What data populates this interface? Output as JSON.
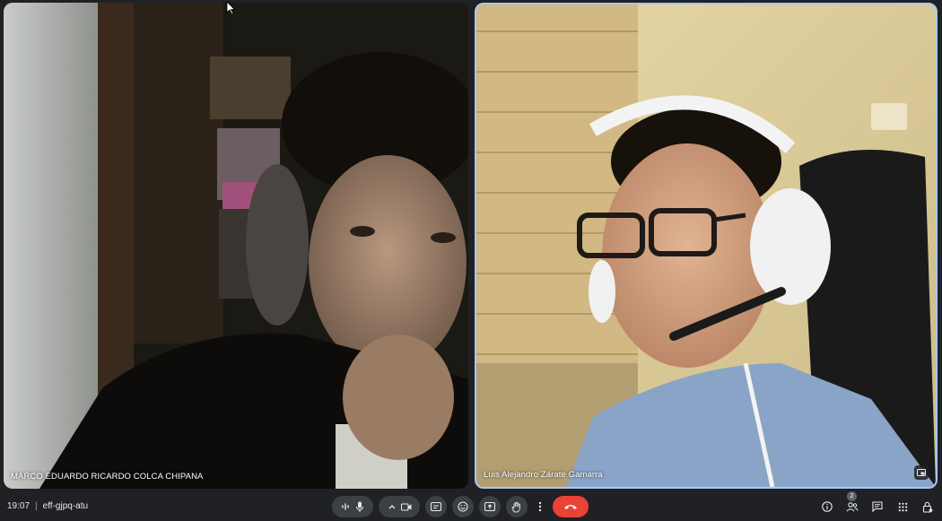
{
  "participants": [
    {
      "name": "MARCO EDUARDO RICARDO COLCA CHIPANA"
    },
    {
      "name": "Luis Alejandro Zárate Gamarra"
    }
  ],
  "meeting": {
    "time": "19:07",
    "separator": "|",
    "code": "eff-gjpq-atu"
  },
  "people_count": "2",
  "colors": {
    "end_call": "#ea4335",
    "active_speaker_border": "#a8c7fa",
    "background": "#202124"
  }
}
